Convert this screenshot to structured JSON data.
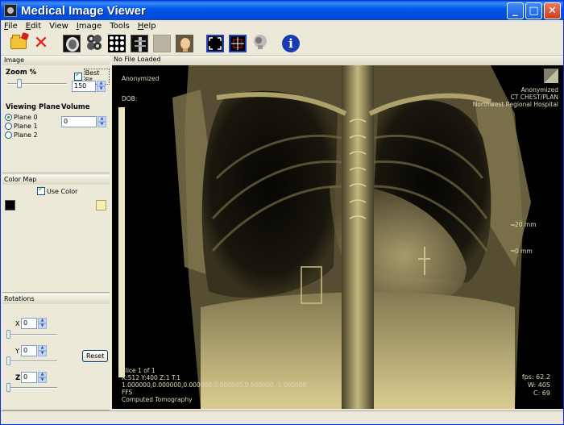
{
  "window": {
    "title": "Medical Image Viewer"
  },
  "title_buttons": {
    "minimize": "_",
    "maximize": "□",
    "close": "✕"
  },
  "menu": [
    {
      "label": "File",
      "u": "F",
      "rest": "ile"
    },
    {
      "label": "Edit",
      "u": "E",
      "rest": "dit"
    },
    {
      "label": "View",
      "u": "",
      "rest": "View"
    },
    {
      "label": "Image",
      "u": "I",
      "rest": "mage"
    },
    {
      "label": "Tools",
      "u": "",
      "rest": "Tools"
    },
    {
      "label": "Help",
      "u": "H",
      "rest": "elp"
    }
  ],
  "toolbar": {
    "icons": [
      "open-folder-icon",
      "close-x-icon",
      "brain-axial-icon",
      "brain-slices-icon",
      "grid-layout-icon",
      "spine-icon",
      "blank-icon",
      "head-profile-icon",
      "fit-window-icon",
      "crosshair-icon",
      "skull-3d-icon",
      "info-icon"
    ]
  },
  "image_panel": {
    "header": "Image",
    "zoom_label": "Zoom %",
    "best_fit_label": "Best Fit",
    "best_fit_checked": true,
    "zoom_value": "150",
    "zoom_slider_fraction": 0.2,
    "viewing_plane_label": "Viewing Plane",
    "planes": [
      "Plane 0",
      "Plane 1",
      "Plane 2"
    ],
    "selected_plane": 0,
    "volume_label": "Volume",
    "volume_value": "0"
  },
  "color_panel": {
    "header": "Color Map",
    "use_color_label": "Use Color",
    "use_color_checked": true,
    "left_swatch": "#000000",
    "right_swatch": "#f5efb0"
  },
  "rotation_panel": {
    "header": "Rotations",
    "x_label": "X",
    "x_value": "0",
    "y_label": "Y",
    "y_value": "0",
    "z_label": "Z",
    "z_value": "0",
    "reset_label": "Reset"
  },
  "viewer": {
    "header": "No File Loaded",
    "top_left": [
      "Anonymized",
      "DOB:"
    ],
    "top_right": [
      "Anonymized",
      "CT CHEST/PLAN",
      "Northwest Regional Hospital"
    ],
    "scale_labels": [
      "20 mm",
      "0 mm"
    ],
    "bottom_left": [
      "Slice 1 of 1",
      "X:512 Y:400 Z:1 T:1",
      "1.000000,0.000000,0.000000 0.000000,0.000000,-1.000000",
      "FFS",
      "Computed Tomography"
    ],
    "bottom_right": [
      "fps: 62.2",
      "W: 405",
      "C: 69"
    ],
    "image_tint": "#f2ecc8"
  }
}
